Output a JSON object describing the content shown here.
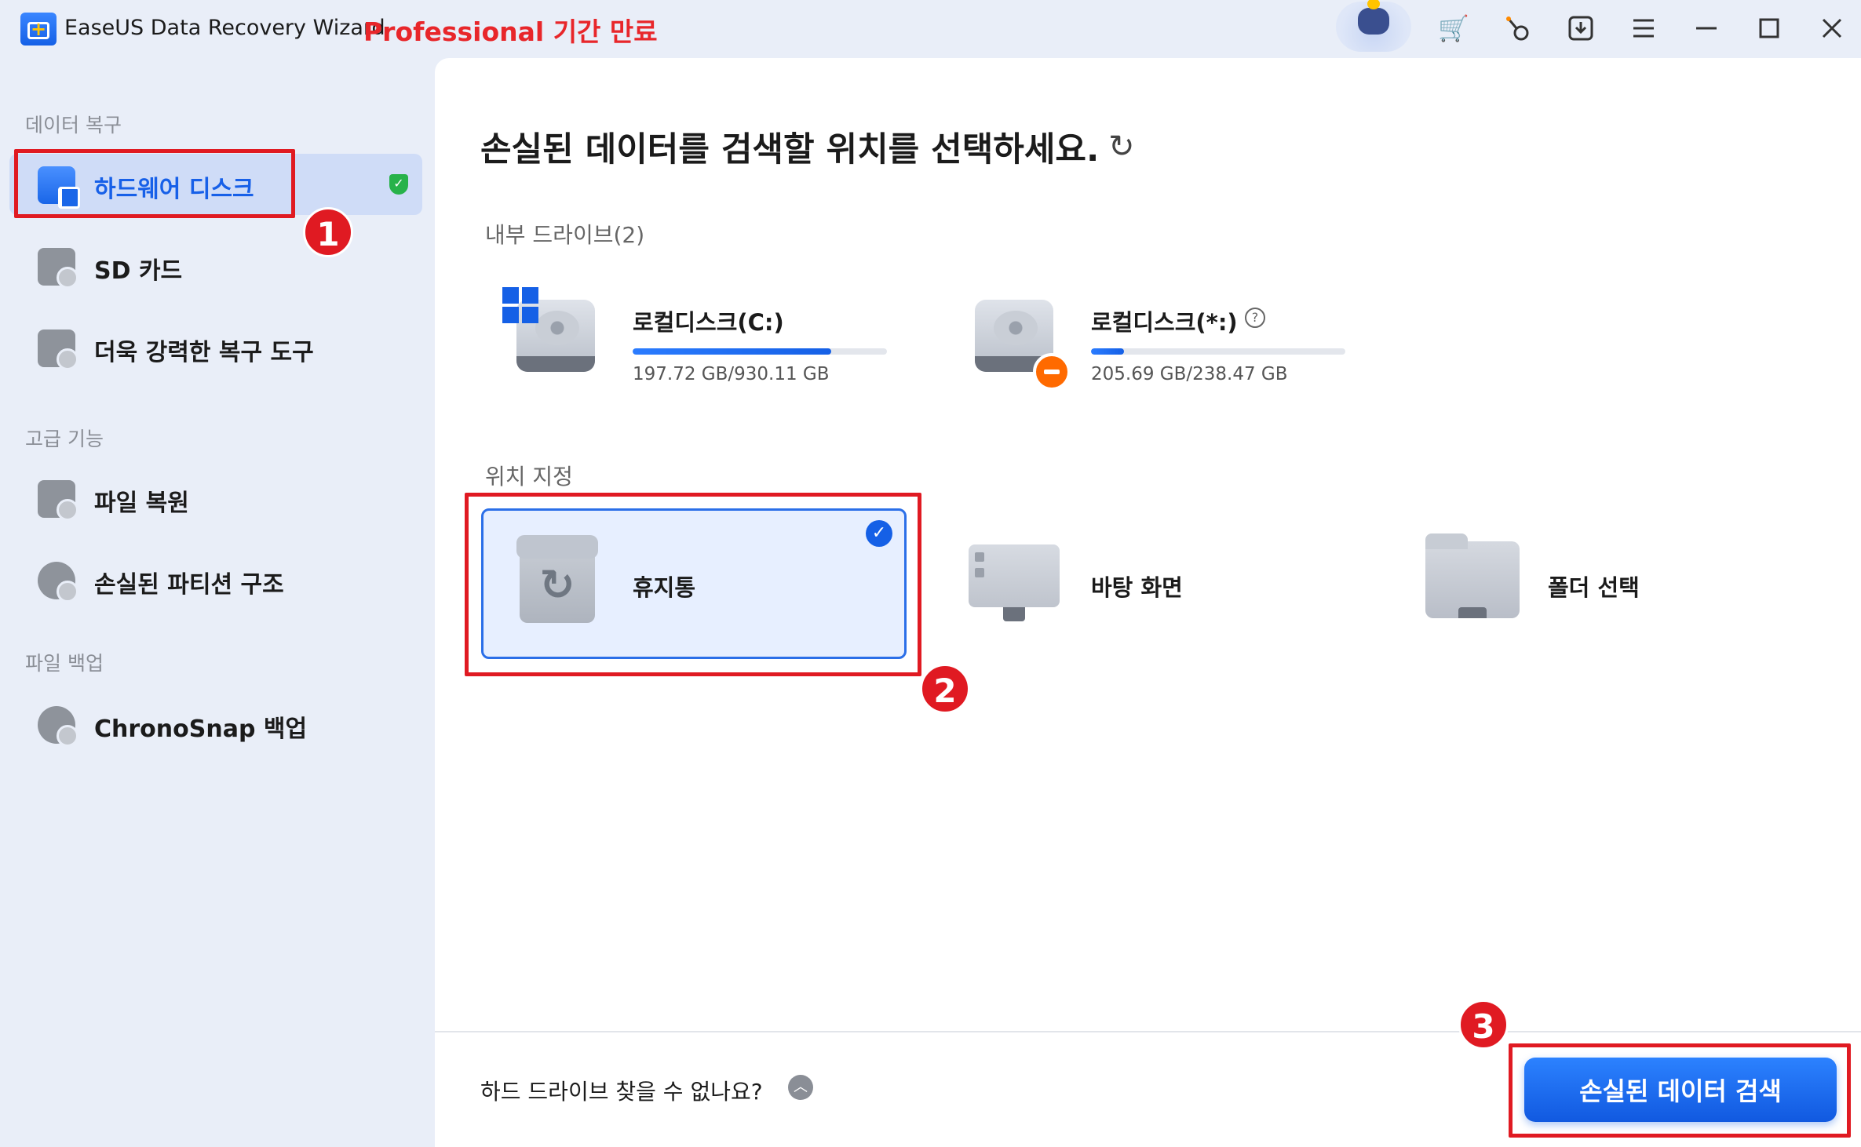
{
  "titlebar": {
    "app_name": "EaseUS Data Recovery Wizard",
    "edition": "Professional 기간 만료"
  },
  "sidebar": {
    "section_recovery": "데이터 복구",
    "section_advanced": "고급 기능",
    "section_backup": "파일 백업",
    "items": [
      {
        "label": "하드웨어 디스크"
      },
      {
        "label": "SD 카드"
      },
      {
        "label": "더욱 강력한 복구 도구"
      },
      {
        "label": "파일 복원"
      },
      {
        "label": "손실된 파티션 구조"
      },
      {
        "label": "ChronoSnap 백업"
      }
    ]
  },
  "main": {
    "title": "손실된 데이터를 검색할 위치를 선택하세요.",
    "internal_drives_label": "내부 드라이브(2)",
    "drives": [
      {
        "name": "로컬디스크(C:)",
        "size": "197.72 GB/930.11 GB",
        "used_fraction": 0.78
      },
      {
        "name": "로컬디스크(*:)",
        "size": "205.69 GB/238.47 GB",
        "used_fraction": 0.13
      }
    ],
    "location_label": "위치 지정",
    "locations": [
      {
        "label": "휴지통"
      },
      {
        "label": "바탕 화면"
      },
      {
        "label": "폴더 선택"
      }
    ]
  },
  "footer": {
    "no_drive_text": "하드 드라이브 찾을 수 없나요?",
    "scan_button": "손실된 데이터 검색"
  },
  "annotations": [
    "1",
    "2",
    "3"
  ],
  "colors": {
    "accent": "#1560e6",
    "annotation_red": "#e01a22",
    "edition_red": "#e8262a",
    "warning_orange": "#ff6a00"
  }
}
